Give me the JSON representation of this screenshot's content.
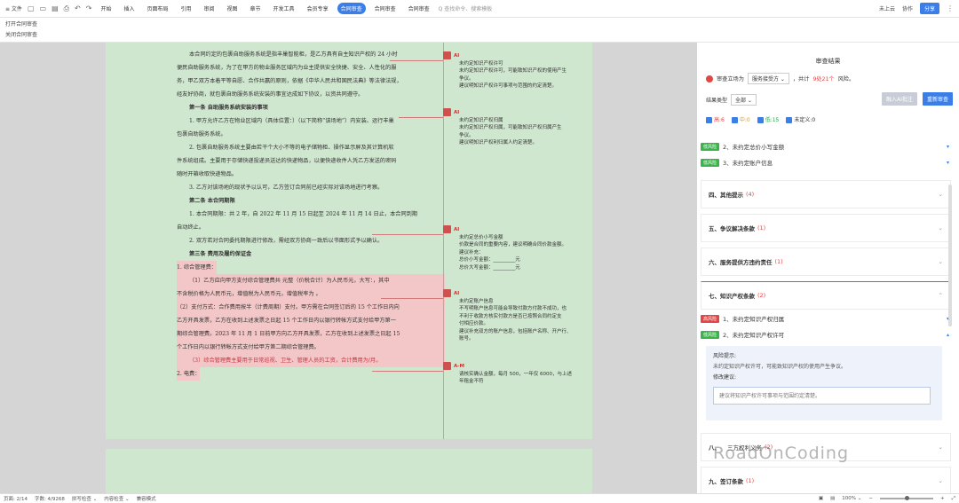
{
  "toolbar": {
    "file": "≡ 文件",
    "tabs": [
      "开始",
      "插入",
      "页面布局",
      "引用",
      "审阅",
      "视图",
      "章节",
      "开发工具",
      "会员专享",
      "合同审查",
      "合同审查",
      "合同审查"
    ],
    "active_tab_index": 9,
    "search": "Q 查找命令、搜索模板",
    "cloud": "未上云",
    "collab": "协作",
    "share": "分享"
  },
  "subbar": {
    "open_label": "打开合同审查",
    "close_label": "关闭合同审查"
  },
  "doc": {
    "lines": [
      "本合同约定的包裹自助服务系统是指丰巢智能柜，是乙方具有自主知识产权的 24 小时",
      "便民自助服务系统，为了在甲方的物业服务区域内为业主提供安全快捷、安全、人性化的服",
      "务，甲乙双方本着平等自愿、合作共赢的原则，依据《中华人民共和国民法典》等法律法规，",
      "经友好协商，就包裹自助服务系统安装的事宜达成如下协议，以资共同遵守。"
    ],
    "art1_title": "第一条   自助服务系统安装的事项",
    "art1_1": "1. 甲方允许乙方在物业区域内（具体位置：）（以下简称“该场地”）内安装、运行丰巢",
    "art1_1b": "包裹自助服务系统。",
    "art1_2": "2.    包裹自助服务系统主要由若干个大小不等的电子储物柜、操作显示屏及其计算机软",
    "art1_2b": "件系统组成。主要用于存储快递投递员送达的快递物品，以便快递收件人凭乙方发送的密码",
    "art1_2c": "随时开箱收取快递物品。",
    "art1_3": "3.    乙方对该场地的现状予以认可，乙方签订合同前已经实际对该场地进行考察。",
    "art2_title": "第二条   本合同期限",
    "art2_1": "1. 本合同期限：共 2 年，自 2022 年 11 月 15 日起至 2024 年 11 月 14 日止，本合同到期",
    "art2_1b": "自动终止。",
    "art2_2": "2. 双方若对合同委托期限进行修改，需经双方协商一致后以书面形式予以确认。",
    "art3_title": "第三条   费用及履约保证金",
    "art3_a": "1. 综合管理费：",
    "art3_b": "（1）乙方应向甲方支付综合管理费共 元整（价税合计）为人民币元，大写：，其中",
    "art3_c": "不含税价格为人民币元，增值税为人民币元，增值税率为 。",
    "art3_d": "（2）支付方式：合作费用按半（计费周期）支付。甲方需在合同签订后的 15 个工作日内向",
    "art3_e": "乙方开具发票，乙方在收到上述发票之日起 15 个工作日内以银行转帐方式支付给甲方第一",
    "art3_f": "期综合管理费。2023 年 11 月 1 日前甲方向乙方开具发票，乙方在收到上述发票之日起 15",
    "art3_g": "个工作日内以银行转帐方式支付给甲方第二期综合管理费。",
    "art3_h": "（3）综合管理费主要用于日常巡视、卫生、管理人员的工资，合计费用为/月。",
    "art3_i": "2. 电费："
  },
  "comments": [
    {
      "who": "AI",
      "text": [
        "未约定知识产权许可",
        "未约定知识产权许可，可能致知识产权的使用产生",
        "争议。",
        "建议明知识产权许可事项与范围的约定清楚。"
      ]
    },
    {
      "who": "AI",
      "text": [
        "未约定知识产权归属",
        "未约定知识产权归属，可能致知识产权归属产生",
        "争议。",
        "建议明知识产权利归属人约定清楚。"
      ]
    },
    {
      "who": "AI",
      "text": [
        "未约定总价小写金额",
        "价款是合同的重要内容，建议明确合同价款金额。",
        "建议补充：",
        "总价小写金额：_________元",
        "总价大写金额：_________元"
      ]
    },
    {
      "who": "AI",
      "text": [
        "未约定账户信息",
        "不写明账户信息可能会导致付款方付款不成功，也",
        "不利于收款方核实付款方是否已按照合同约定支",
        "付相应价款。",
        "建议补充双方的账户信息，包括账户名称、开户行、",
        "账号。"
      ]
    },
    {
      "who": "A-M",
      "text": [
        "请核实确认金额，每月 500，一年仅 6000，与上述",
        "年租金不符"
      ]
    }
  ],
  "panel": {
    "title": "审查结果",
    "stance_label": "审查立场为",
    "stance_value": "服务接受方 ⌄",
    "stance_count_pre": "，共计",
    "stance_count": "9处21个",
    "stance_count_post": "风险。",
    "rtype_label": "结果类型",
    "rtype_value": "全部 ⌄",
    "import_btn": "融入AI批注",
    "rescan_btn": "重新审查",
    "filters": [
      {
        "label": "高:6",
        "cls": "f-high"
      },
      {
        "label": "中:0",
        "cls": "f-mid"
      },
      {
        "label": "低:15",
        "cls": "f-low"
      },
      {
        "label": "未定义:0",
        "cls": "f-undef"
      }
    ],
    "risks_top": [
      {
        "tag": "低风险",
        "text": "2、未约定总价小写金额"
      },
      {
        "tag": "低风险",
        "text": "3、未约定账户信息"
      }
    ],
    "sections": [
      {
        "title": "四、其他提示",
        "count": "(4)"
      },
      {
        "title": "五、争议解决条款",
        "count": "(1)"
      },
      {
        "title": "六、服务提供方违约责任",
        "count": "(1)"
      },
      {
        "title": "七、知识产权条款",
        "count": "(2)"
      }
    ],
    "ip_risks": [
      {
        "tag": "高风险",
        "text": "1、未约定知识产权归属"
      },
      {
        "tag": "低风险",
        "text": "2、未约定知识产权许可"
      }
    ],
    "detail_hint_label": "风险提示:",
    "detail_hint": "未约定知识产权许可，可能致知识产权的使用产生争议。",
    "detail_sugg_label": "修改建议:",
    "detail_input": "建议将知识产权许可事项与范围约定清楚。",
    "sec8": {
      "title": "八、",
      "extra": "三方权利义务",
      "count": "(2)"
    },
    "sec9": {
      "title": "九、签订条款",
      "count": "(1)"
    }
  },
  "status": {
    "page": "页面: 2/14",
    "words": "字数: 4/9268",
    "spell": "拼写检查 ⌄",
    "content": "内容检查 ⌄",
    "mode": "兼容模式",
    "zoom": "100% ⌄"
  },
  "watermark": "RoadOnCoding"
}
